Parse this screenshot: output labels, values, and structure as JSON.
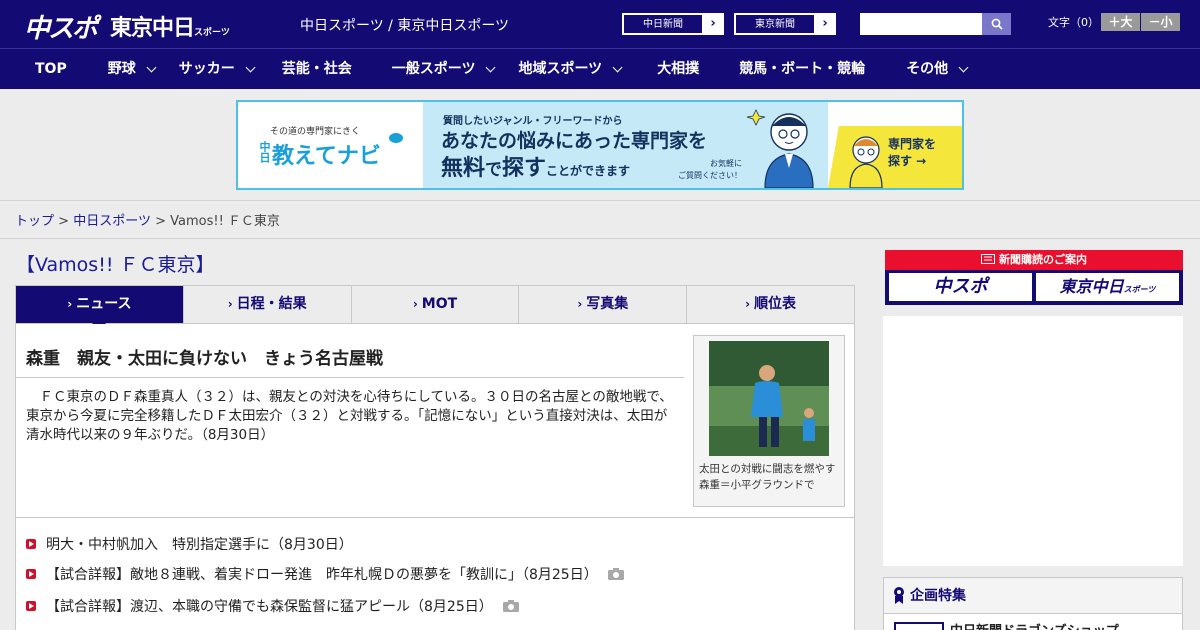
{
  "header": {
    "logo_chuspo": "中スポ",
    "logo_tokyo": "東京中日",
    "logo_tokyo_sub": "スポーツ",
    "site_name": "中日スポーツ / 東京中日スポーツ",
    "paper_links": [
      "中日新聞",
      "東京新聞"
    ],
    "search_placeholder": "",
    "font_size_label": "文字（0）",
    "font_larger": "＋大",
    "font_smaller": "－小"
  },
  "nav": {
    "items": [
      {
        "label": "TOP",
        "has_menu": false
      },
      {
        "label": "野球",
        "has_menu": true
      },
      {
        "label": "サッカー",
        "has_menu": true
      },
      {
        "label": "芸能・社会",
        "has_menu": false
      },
      {
        "label": "一般スポーツ",
        "has_menu": true
      },
      {
        "label": "地域スポーツ",
        "has_menu": true
      },
      {
        "label": "大相撲",
        "has_menu": false
      },
      {
        "label": "競馬・ボート・競輪",
        "has_menu": false
      },
      {
        "label": "その他",
        "has_menu": true
      }
    ]
  },
  "banner": {
    "tagline_small": "その道の専門家にきく",
    "brand_prefix": "中日",
    "brand": "教えてナビ",
    "question": "質問したいジャンル・フリーワードから",
    "headline1": "あなたの悩みにあった専門家を",
    "headline2_a": "無料",
    "headline2_b": "で",
    "headline2_c": "探す",
    "headline2_d": "ことができます",
    "casual1": "お気軽に",
    "casual2": "ご質問ください！",
    "cta1": "専門家を",
    "cta2": "探す →"
  },
  "breadcrumb": {
    "home": "トップ",
    "section": "中日スポーツ",
    "sep": ">",
    "current": "Vamos!! ＦＣ東京"
  },
  "page_title": "【Vamos!! ＦＣ東京】",
  "tabs": [
    {
      "label": "ニュース",
      "active": true
    },
    {
      "label": "日程・結果",
      "active": false
    },
    {
      "label": "MOT",
      "active": false
    },
    {
      "label": "写真集",
      "active": false
    },
    {
      "label": "順位表",
      "active": false
    }
  ],
  "article": {
    "title": "森重　親友・太田に負けない　きょう名古屋戦",
    "body": "　ＦＣ東京のＤＦ森重真人（３２）は、親友との対決を心待ちにしている。３０日の名古屋との敵地戦で、東京から今夏に完全移籍したＤＦ太田宏介（３２）と対戦する。「記憶にない」という直接対決は、太田が清水時代以来の９年ぶりだ。（8月30日）",
    "photo_caption": "太田との対戦に闘志を燃やす森重＝小平グラウンドで"
  },
  "news_list": [
    {
      "text": "明大・中村帆加入　特別指定選手に（8月30日）",
      "photo": false
    },
    {
      "text": "【試合詳報】敵地８連戦、着実ドロー発進　昨年札幌Ｄの悪夢を「教訓に」（8月25日）",
      "photo": true
    },
    {
      "text": "【試合詳報】渡辺、本職の守備でも森保監督に猛アピール（8月25日）",
      "photo": true
    }
  ],
  "sidebar": {
    "subscribe_head": "新聞購読のご案内",
    "subscribe_chuspo": "中スポ",
    "subscribe_tokyo": "東京中日",
    "subscribe_tokyo_sub": "スポーツ",
    "feature_head": "企画特集",
    "feature_item": "中日新聞ドラゴンズショップ"
  },
  "colors": {
    "brand_navy": "#140a73",
    "accent_red": "#e8102e",
    "banner_blue": "#4fc0e8"
  }
}
